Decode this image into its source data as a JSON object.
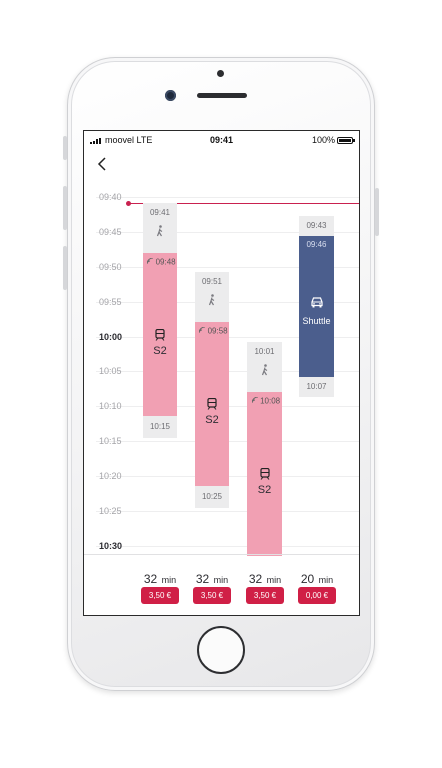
{
  "status_bar": {
    "carrier": "moovel LTE",
    "time": "09:41",
    "battery": "100%"
  },
  "timeline": {
    "labels": [
      "09:40",
      "09:45",
      "09:50",
      "09:55",
      "10:00",
      "10:05",
      "10:10",
      "10:15",
      "10:20",
      "10:25",
      "10:30"
    ],
    "major_labels": [
      "10:00",
      "10:30"
    ]
  },
  "routes": [
    {
      "walk_start": "09:41",
      "depart": "09:48",
      "line": "S2",
      "arrive": "10:15",
      "duration_value": "32",
      "duration_unit": "min",
      "price": "3,50 €"
    },
    {
      "walk_start": "09:51",
      "depart": "09:58",
      "line": "S2",
      "arrive": "10:25",
      "duration_value": "32",
      "duration_unit": "min",
      "price": "3,50 €"
    },
    {
      "walk_start": "10:01",
      "depart": "10:08",
      "line": "S2",
      "arrive": "",
      "duration_value": "32",
      "duration_unit": "min",
      "price": "3,50 €"
    },
    {
      "walk_start": "09:43",
      "depart": "09:46",
      "line": "Shuttle",
      "arrive": "10:07",
      "duration_value": "20",
      "duration_unit": "min",
      "price": "0,00 €"
    }
  ],
  "colors": {
    "accent": "#d01f46",
    "train_segment": "#f1a0b3",
    "shuttle_segment": "#4b5e8d",
    "walk_segment": "#ececed",
    "now_line": "#c9214f"
  },
  "icons": [
    "back-icon",
    "walk-icon",
    "train-icon",
    "shuttle-icon",
    "signal-icon",
    "battery-icon"
  ]
}
